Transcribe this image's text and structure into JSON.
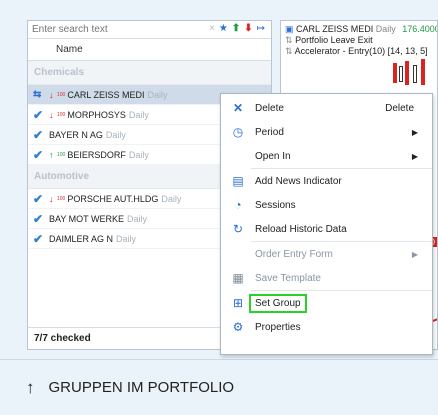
{
  "search": {
    "placeholder": "Enter search text",
    "value": ""
  },
  "search_tools": {
    "clear": "×",
    "star": "★",
    "up": "⬆",
    "down": "⬇",
    "resize": "↦"
  },
  "list": {
    "column_name": "Name",
    "groups": [
      {
        "label": "Chemicals",
        "rows": [
          {
            "dir": "down",
            "tiny": "100",
            "symbol": "CARL ZEISS MEDI",
            "period": "Daily",
            "selected": true
          },
          {
            "dir": "down",
            "tiny": "100",
            "symbol": "MORPHOSYS",
            "period": "Daily"
          },
          {
            "dir": "",
            "tiny": "",
            "symbol": "BAYER N AG",
            "period": "Daily"
          },
          {
            "dir": "up",
            "tiny": "100",
            "symbol": "BEIERSDORF",
            "period": "Daily"
          }
        ]
      },
      {
        "label": "Automotive",
        "rows": [
          {
            "dir": "down",
            "tiny": "100",
            "symbol": "PORSCHE AUT.HLDG",
            "period": "Daily"
          },
          {
            "dir": "",
            "tiny": "",
            "symbol": "BAY MOT WERKE",
            "period": "Daily"
          },
          {
            "dir": "",
            "tiny": "",
            "symbol": "DAIMLER AG N",
            "period": "Daily"
          }
        ]
      }
    ],
    "footer": "7/7 checked"
  },
  "chart": {
    "symbol": "CARL ZEISS MEDI",
    "period": "Daily",
    "price": "176.4000",
    "line2": "Portfolio Leave Exit",
    "line3": "Accelerator - Entry(10) [14, 13, 5]",
    "axis_label": "00"
  },
  "menu": {
    "items": [
      {
        "icon": "delete-icon",
        "label": "Delete",
        "shortcut": "Delete"
      },
      {
        "icon": "clock-icon",
        "label": "Period",
        "submenu": true
      },
      {
        "icon": "",
        "label": "Open In",
        "submenu": true
      },
      {
        "icon": "news-indicator-icon",
        "label": "Add News Indicator"
      },
      {
        "icon": "sessions-icon",
        "label": "Sessions"
      },
      {
        "icon": "reload-icon",
        "label": "Reload Historic Data"
      },
      {
        "icon": "",
        "label": "Order Entry Form",
        "submenu": true,
        "disabled": true
      },
      {
        "icon": "save-template-icon",
        "label": "Save Template",
        "disabled": true
      },
      {
        "icon": "set-group-icon",
        "label": "Set Group",
        "highlighted": true
      },
      {
        "icon": "properties-icon",
        "label": "Properties"
      }
    ]
  },
  "caption": {
    "arrow": "↑",
    "text": "GRUPPEN IM PORTFOLIO"
  },
  "colors": {
    "accent": "#2c6fd1",
    "highlight": "#2bd12b",
    "up": "#1d9c43",
    "down": "#dd2222"
  }
}
